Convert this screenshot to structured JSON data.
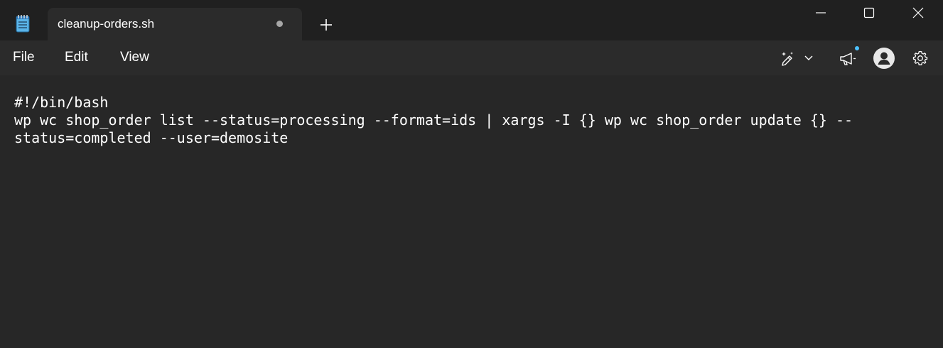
{
  "tab": {
    "title": "cleanup-orders.sh",
    "unsaved": true
  },
  "menu": {
    "file": "File",
    "edit": "Edit",
    "view": "View"
  },
  "toolbar": {
    "icons": [
      "copilot-pen-icon",
      "chevron-down-icon",
      "megaphone-icon",
      "account-icon",
      "gear-icon"
    ]
  },
  "window_controls": [
    "minimize-icon",
    "maximize-icon",
    "close-icon"
  ],
  "editor": {
    "lines": [
      "#!/bin/bash",
      "wp wc shop_order list --status=processing --format=ids | xargs -I {} wp wc shop_order update {} --",
      "status=completed --user=demosite"
    ]
  },
  "colors": {
    "titlebar_bg": "#202020",
    "editor_bg": "#272727",
    "text": "#ffffff",
    "accent_dot": "#4cc2ff"
  }
}
